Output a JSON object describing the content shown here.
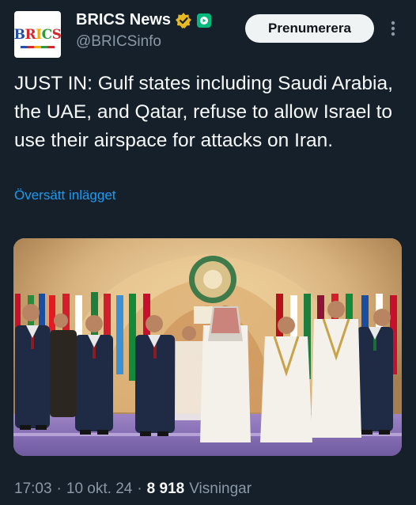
{
  "header": {
    "avatar_logo": "BRICS",
    "display_name": "BRICS News",
    "handle": "@BRICSinfo",
    "badge_icons": [
      "gold-verified-badge-icon",
      "green-affiliate-badge-icon"
    ],
    "subscribe_label": "Prenumerera",
    "more_icon": "vertical-ellipsis-icon"
  },
  "tweet": {
    "text": "JUST IN: Gulf states including Saudi Arabia, the UAE, and Qatar, refuse to allow Israel to use their airspace for attacks on Iran.",
    "translate_label": "Översätt inlägget"
  },
  "media": {
    "type": "photo",
    "scene": "group-photo-of-leaders-on-stage"
  },
  "footer": {
    "time": "17:03",
    "separator1": "·",
    "date": "10 okt. 24",
    "separator2": "·",
    "views_count": "8 918",
    "views_label": "Visningar"
  },
  "colors": {
    "background": "#15202b",
    "text": "#f7f9f9",
    "muted": "#8b98a5",
    "link": "#1d9bf0",
    "verified_gold": "#e8b923",
    "affiliate_green": "#00ba7c"
  }
}
